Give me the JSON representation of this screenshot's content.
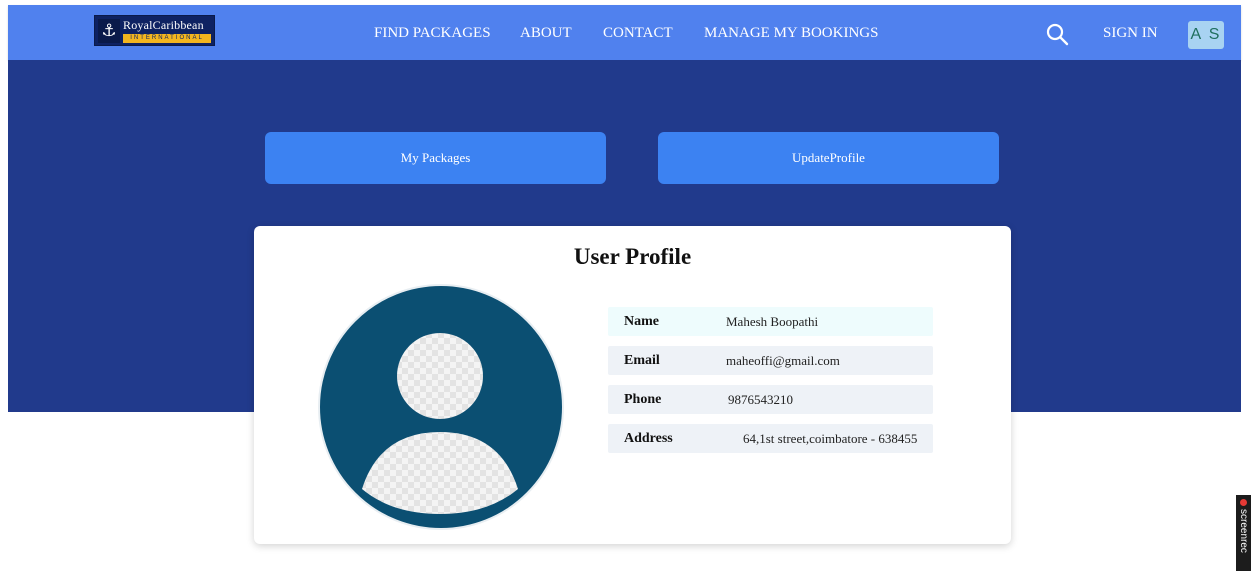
{
  "brand": {
    "name": "RoyalCaribbean",
    "sub": "INTERNATIONAL",
    "colors": {
      "navy": "#0e2262",
      "gold": "#f2b51f"
    }
  },
  "nav": {
    "links": [
      "FIND PACKAGES",
      "ABOUT",
      "CONTACT",
      "MANAGE MY BOOKINGS"
    ],
    "sign_in": "SIGN IN",
    "avatar_initials": "A S",
    "search_icon": "search-icon"
  },
  "tabs": {
    "my_packages": "My Packages",
    "update_profile": "UpdateProfile"
  },
  "profile": {
    "title": "User Profile",
    "fields": [
      {
        "label": "Name",
        "value": "Mahesh Boopathi"
      },
      {
        "label": "Email",
        "value": "maheoffi@gmail.com"
      },
      {
        "label": "Phone",
        "value": "9876543210"
      },
      {
        "label": "Address",
        "value": "64,1st street,coimbatore - 638455"
      }
    ]
  },
  "recorder": {
    "label": "screenrec"
  },
  "colors": {
    "navbar": "#5081ee",
    "hero": "#213a8c",
    "button": "#3c82f2",
    "avatar_circle": "#0b4f72"
  }
}
